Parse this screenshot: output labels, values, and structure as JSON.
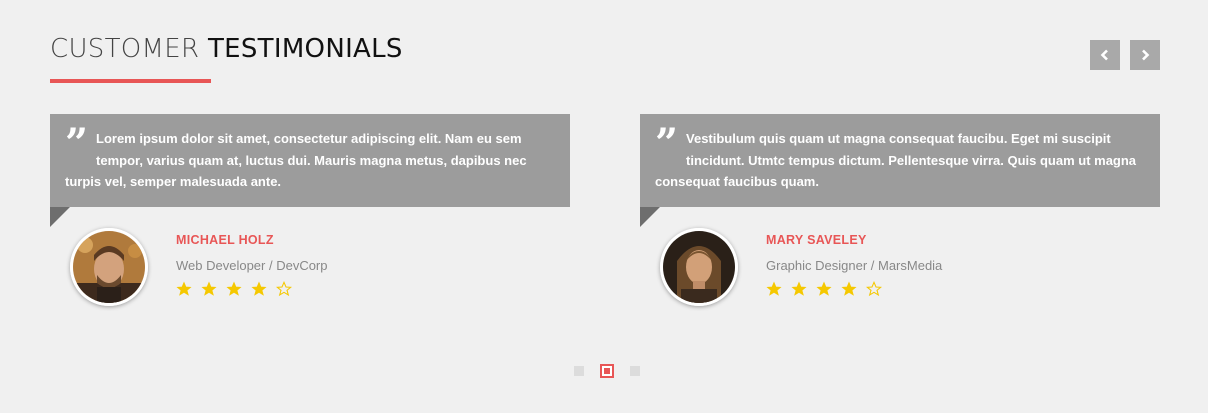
{
  "header": {
    "title_light": "CUSTOMER",
    "title_bold": "TESTIMONIALS",
    "accent_color": "#e85656"
  },
  "nav": {
    "prev_icon": "chevron-left-icon",
    "next_icon": "chevron-right-icon"
  },
  "testimonials": [
    {
      "quote": "Lorem ipsum dolor sit amet, consectetur adipiscing elit. Nam eu sem tempor, varius quam at, luctus dui. Mauris magna metus, dapibus nec turpis vel, semper malesuada ante.",
      "name": "MICHAEL HOLZ",
      "role": "Web Developer / DevCorp",
      "rating": 4,
      "max_rating": 5
    },
    {
      "quote": "Vestibulum quis quam ut magna consequat faucibu. Eget mi suscipit tincidunt. Utmtc tempus dictum. Pellentesque virra. Quis quam ut magna consequat faucibus quam.",
      "name": "MARY SAVELEY",
      "role": "Graphic Designer / MarsMedia",
      "rating": 4,
      "max_rating": 5
    }
  ],
  "pagination": {
    "pages": 3,
    "active_page": 2
  },
  "colors": {
    "quote_bg": "#9c9c9c",
    "star": "#f5c800",
    "nav_bg": "#a9a9a9"
  }
}
